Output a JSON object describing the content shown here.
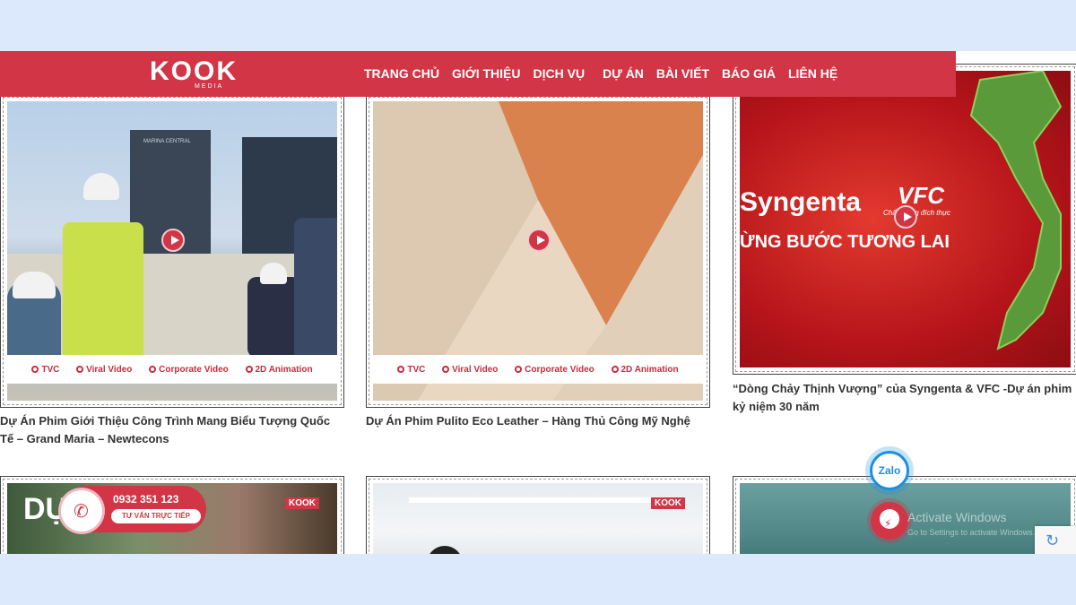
{
  "logo": {
    "mark": "KOOK",
    "sub": "MEDIA"
  },
  "nav": [
    "TRANG CHỦ",
    "GIỚI THIỆU",
    "DỊCH VỤ",
    "DỰ ÁN",
    "BÀI VIẾT",
    "BÁO GIÁ",
    "LIÊN HỆ"
  ],
  "video_tags": [
    "TVC",
    "Viral Video",
    "Corporate Video",
    "2D Animation"
  ],
  "projects": [
    {
      "caption": "Dự Án Phim Giới Thiệu Công Trình Mang Biểu Tượng Quốc Tế – Grand Maria – Newtecons",
      "overlay": "MARINA CENTRAL"
    },
    {
      "caption": "Dự Án Phim Pulito Eco Leather – Hàng Thủ Công Mỹ Nghệ"
    },
    {
      "caption": "“Dòng Chảy Thịnh Vượng” của Syngenta & VFC -Dự án phim kỷ niệm 30 năm",
      "overlay_brand1": "Syngenta",
      "overlay_brand2": "VFC",
      "overlay_brand2_sub": "Chất lượng đích thực",
      "overlay_slogan": "ỪNG BƯỚC TƯƠNG LAI"
    },
    {
      "caption": "",
      "overlay": "DỰ"
    },
    {
      "caption": ""
    },
    {
      "caption": ""
    }
  ],
  "thumb_logo": "KOOK",
  "phone": {
    "number": "0932 351 123",
    "label": "TƯ VẤN TRỰC TIẾP"
  },
  "zalo_label": "Zalo",
  "watermark": {
    "title": "Activate Windows",
    "sub": "Go to Settings to activate Windows."
  },
  "colors": {
    "brand": "#d23545",
    "page_bg": "#dce8fb",
    "zalo": "#1a8fe0"
  }
}
